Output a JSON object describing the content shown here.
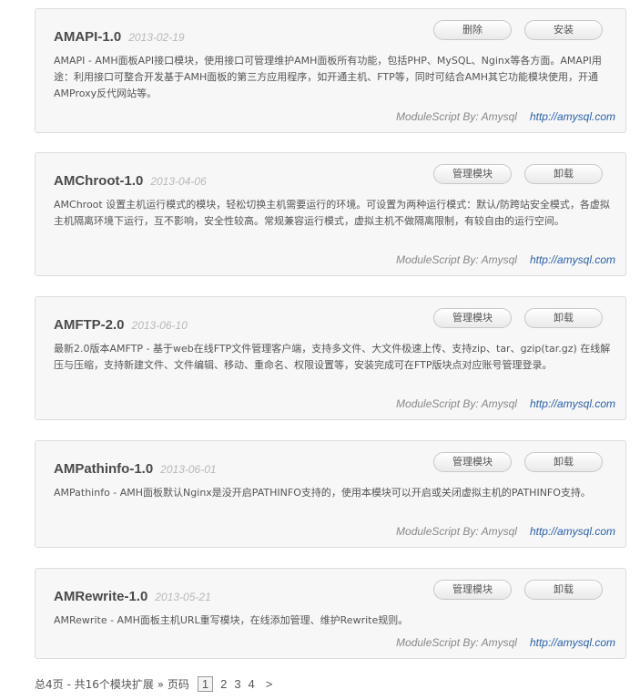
{
  "modules": [
    {
      "title": "AMAPI-1.0",
      "date": "2013-02-19",
      "buttons": [
        "删除",
        "安装"
      ],
      "description": "AMAPI - AMH面板API接口模块，使用接口可管理维护AMH面板所有功能，包括PHP、MySQL、Nginx等各方面。AMAPI用途：利用接口可整合开发基于AMH面板的第三方应用程序，如开通主机、FTP等，同时可结合AMH其它功能模块使用，开通AMProxy反代网站等。",
      "author": "ModuleScript By: Amysql",
      "link": "http://amysql.com"
    },
    {
      "title": "AMChroot-1.0",
      "date": "2013-04-06",
      "buttons": [
        "管理模块",
        "卸载"
      ],
      "description": "AMChroot 设置主机运行模式的模块，轻松切换主机需要运行的环境。可设置为两种运行模式：默认/防跨站安全模式，各虚拟主机隔离环境下运行，互不影响，安全性较高。常规兼容运行模式，虚拟主机不做隔离限制，有较自由的运行空间。",
      "author": "ModuleScript By: Amysql",
      "link": "http://amysql.com"
    },
    {
      "title": "AMFTP-2.0",
      "date": "2013-06-10",
      "buttons": [
        "管理模块",
        "卸载"
      ],
      "description": "最新2.0版本AMFTP - 基于web在线FTP文件管理客户端，支持多文件、大文件极速上传、支持zip、tar、gzip(tar.gz) 在线解压与压缩，支持新建文件、文件编辑、移动、重命名、权限设置等，安装完成可在FTP版块点对应账号管理登录。",
      "author": "ModuleScript By: Amysql",
      "link": "http://amysql.com"
    },
    {
      "title": "AMPathinfo-1.0",
      "date": "2013-06-01",
      "buttons": [
        "管理模块",
        "卸载"
      ],
      "description": "AMPathinfo - AMH面板默认Nginx是没开启PATHINFO支持的，使用本模块可以开启或关闭虚拟主机的PATHINFO支持。",
      "author": "ModuleScript By: Amysql",
      "link": "http://amysql.com"
    },
    {
      "title": "AMRewrite-1.0",
      "date": "2013-05-21",
      "buttons": [
        "管理模块",
        "卸载"
      ],
      "description": "AMRewrite - AMH面板主机URL重写模块，在线添加管理、维护Rewrite规则。",
      "author": "ModuleScript By: Amysql",
      "link": "http://amysql.com"
    }
  ],
  "pagination": {
    "summary": "总4页 - 共16个模块扩展 » 页码",
    "pages": [
      "1",
      "2",
      "3",
      "4"
    ],
    "current": "1",
    "next": ">"
  }
}
